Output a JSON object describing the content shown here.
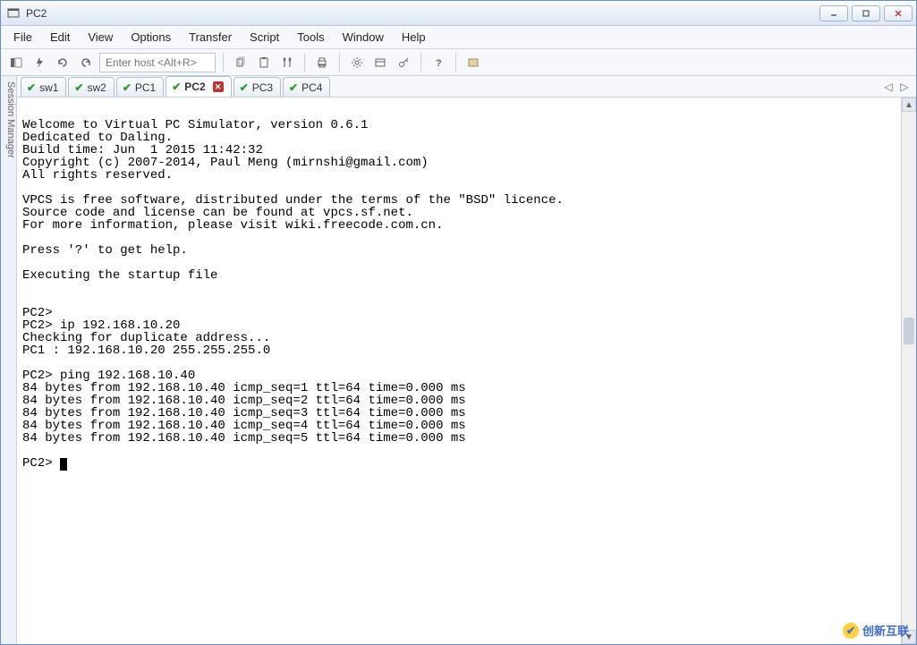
{
  "window": {
    "title": "PC2"
  },
  "menus": [
    "File",
    "Edit",
    "View",
    "Options",
    "Transfer",
    "Script",
    "Tools",
    "Window",
    "Help"
  ],
  "toolbar": {
    "host_placeholder": "Enter host <Alt+R>"
  },
  "sidebar": {
    "label": "Session Manager"
  },
  "tabs": [
    {
      "label": "sw1",
      "active": false,
      "closeable": false
    },
    {
      "label": "sw2",
      "active": false,
      "closeable": false
    },
    {
      "label": "PC1",
      "active": false,
      "closeable": false
    },
    {
      "label": "PC2",
      "active": true,
      "closeable": true
    },
    {
      "label": "PC3",
      "active": false,
      "closeable": false
    },
    {
      "label": "PC4",
      "active": false,
      "closeable": false
    }
  ],
  "terminal": {
    "lines": [
      "",
      "Welcome to Virtual PC Simulator, version 0.6.1",
      "Dedicated to Daling.",
      "Build time: Jun  1 2015 11:42:32",
      "Copyright (c) 2007-2014, Paul Meng (mirnshi@gmail.com)",
      "All rights reserved.",
      "",
      "VPCS is free software, distributed under the terms of the \"BSD\" licence.",
      "Source code and license can be found at vpcs.sf.net.",
      "For more information, please visit wiki.freecode.com.cn.",
      "",
      "Press '?' to get help.",
      "",
      "Executing the startup file",
      "",
      "",
      "PC2>",
      "PC2> ip 192.168.10.20",
      "Checking for duplicate address...",
      "PC1 : 192.168.10.20 255.255.255.0",
      "",
      "PC2> ping 192.168.10.40",
      "84 bytes from 192.168.10.40 icmp_seq=1 ttl=64 time=0.000 ms",
      "84 bytes from 192.168.10.40 icmp_seq=2 ttl=64 time=0.000 ms",
      "84 bytes from 192.168.10.40 icmp_seq=3 ttl=64 time=0.000 ms",
      "84 bytes from 192.168.10.40 icmp_seq=4 ttl=64 time=0.000 ms",
      "84 bytes from 192.168.10.40 icmp_seq=5 ttl=64 time=0.000 ms",
      ""
    ],
    "prompt": "PC2> "
  },
  "watermark": {
    "text": "创新互联"
  }
}
